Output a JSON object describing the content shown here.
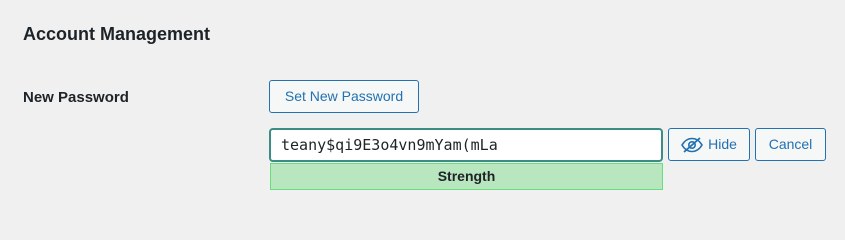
{
  "section": {
    "title": "Account Management"
  },
  "new_password": {
    "label": "New Password",
    "set_button_label": "Set New Password",
    "input_value": "teany$qi9E3o4vn9mYam(mLa",
    "strength_text": "Strength",
    "hide_button_label": "Hide",
    "cancel_button_label": "Cancel"
  },
  "icons": {
    "hide": "eye-slash-icon"
  },
  "colors": {
    "accent": "#2271b1",
    "input_border": "#3a8c84",
    "strong_bg": "#b8e6bf",
    "strong_border": "#68de7c",
    "page_bg": "#f0f0f1"
  }
}
